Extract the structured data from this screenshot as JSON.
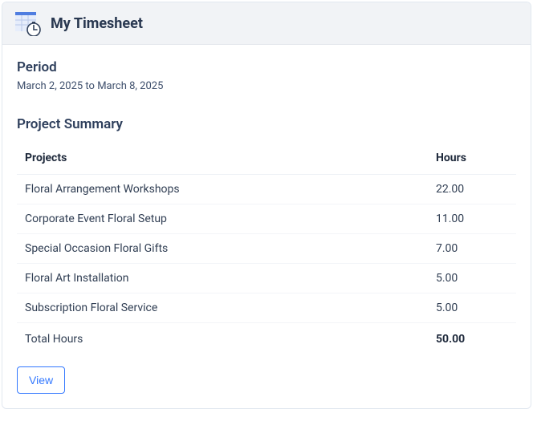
{
  "header": {
    "title": "My Timesheet"
  },
  "period": {
    "label": "Period",
    "text": "March 2, 2025 to March 8, 2025"
  },
  "summary": {
    "heading": "Project Summary",
    "columns": {
      "projects": "Projects",
      "hours": "Hours"
    },
    "rows": [
      {
        "name": "Floral Arrangement Workshops",
        "hours": "22.00"
      },
      {
        "name": "Corporate Event Floral Setup",
        "hours": "11.00"
      },
      {
        "name": "Special Occasion Floral Gifts",
        "hours": "7.00"
      },
      {
        "name": "Floral Art Installation",
        "hours": "5.00"
      },
      {
        "name": "Subscription Floral Service",
        "hours": "5.00"
      }
    ],
    "total": {
      "label": "Total Hours",
      "value": "50.00"
    }
  },
  "actions": {
    "view": "View"
  },
  "colors": {
    "accent": "#3378ff"
  }
}
